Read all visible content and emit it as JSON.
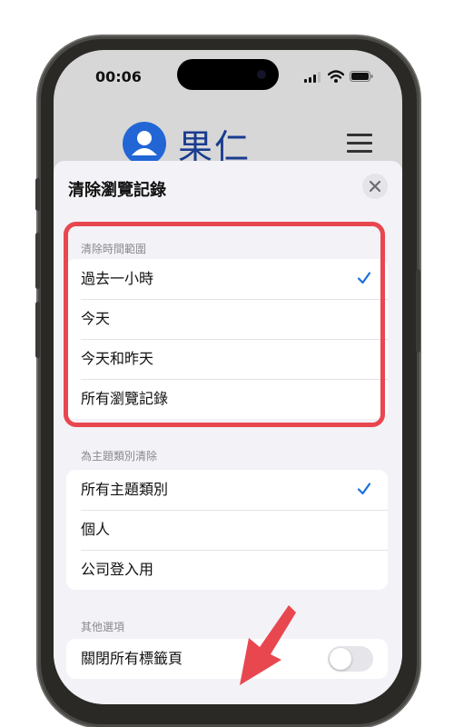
{
  "status_bar": {
    "time": "00:06"
  },
  "website": {
    "name": "果仁"
  },
  "sheet": {
    "title": "清除瀏覽記錄",
    "time_range": {
      "header": "清除時間範圍",
      "options": [
        {
          "label": "過去一小時",
          "selected": true
        },
        {
          "label": "今天",
          "selected": false
        },
        {
          "label": "今天和昨天",
          "selected": false
        },
        {
          "label": "所有瀏覽記錄",
          "selected": false
        }
      ]
    },
    "profiles": {
      "header": "為主題類別清除",
      "options": [
        {
          "label": "所有主題類別",
          "selected": true
        },
        {
          "label": "個人",
          "selected": false
        },
        {
          "label": "公司登入用",
          "selected": false
        }
      ]
    },
    "other": {
      "header": "其他選項",
      "close_all_tabs": {
        "label": "關閉所有標籤頁",
        "enabled": false
      }
    }
  },
  "colors": {
    "accent": "#1a6fe0",
    "highlight": "#e8474f"
  }
}
